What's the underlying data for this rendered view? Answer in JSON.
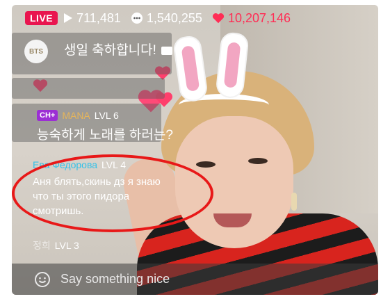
{
  "top": {
    "live_label": "LIVE",
    "views": "711,481",
    "comments": "1,540,255",
    "hearts": "10,207,146"
  },
  "chat": {
    "first": {
      "avatar_text": "BTS",
      "text": "생일 축하합니다!"
    },
    "second": {
      "badge": "CH+",
      "username": "MANA",
      "level": "LVL 6",
      "text": "능숙하게 노래를 하러는?"
    },
    "third": {
      "username": "Ева Федорова",
      "level": "LVL 4",
      "line1": "Аня блять,скинь дз я знаю",
      "line2": "что ты этого пидора",
      "line3": "смотришь."
    },
    "fourth": {
      "username": "정희",
      "level": "LVL 3"
    }
  },
  "input": {
    "placeholder": "Say something nice"
  },
  "colors": {
    "live": "#e9154f",
    "heart": "#ff2d55",
    "circle": "#e81818",
    "ch_badge": "#9c2fd4"
  }
}
